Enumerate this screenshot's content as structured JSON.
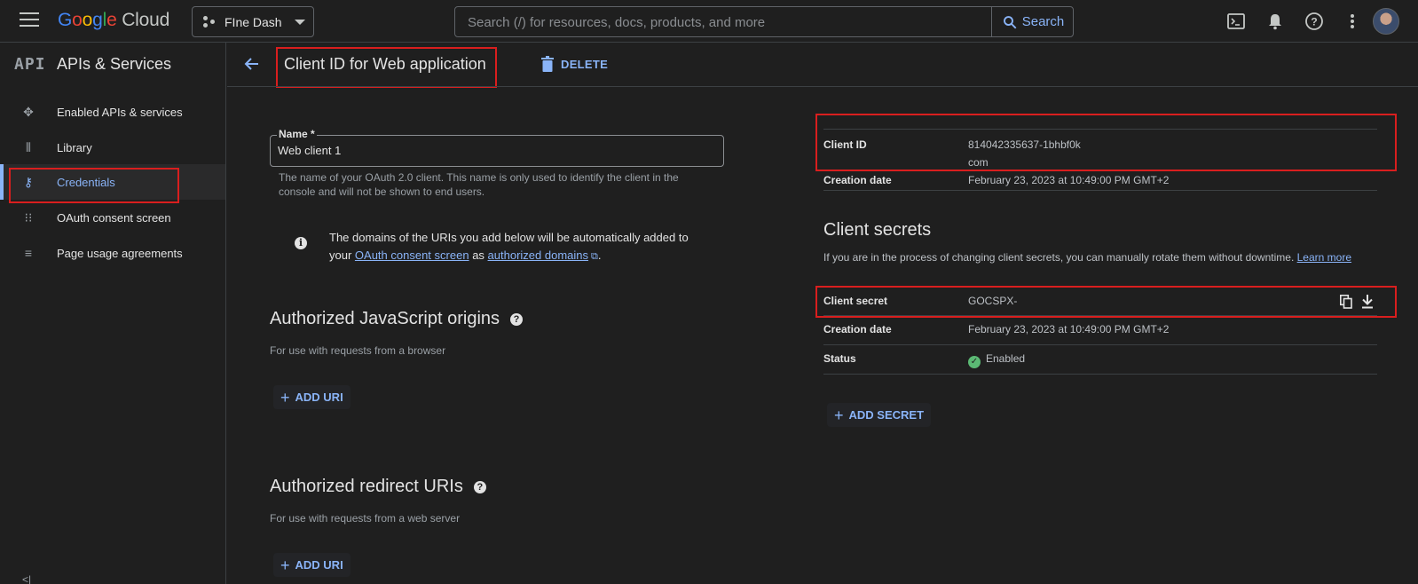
{
  "topbar": {
    "brand_google": [
      "G",
      "o",
      "o",
      "g",
      "l",
      "e"
    ],
    "brand_cloud": "Cloud",
    "project_name": "FIne Dash",
    "search_placeholder": "Search (/) for resources, docs, products, and more",
    "search_button": "Search"
  },
  "sidebar": {
    "logo_text": "API",
    "title": "APIs & Services",
    "items": [
      {
        "label": "Enabled APIs & services",
        "icon": "apis-hub-icon"
      },
      {
        "label": "Library",
        "icon": "library-icon"
      },
      {
        "label": "Credentials",
        "icon": "key-icon",
        "active": true
      },
      {
        "label": "OAuth consent screen",
        "icon": "consent-icon"
      },
      {
        "label": "Page usage agreements",
        "icon": "settings-list-icon"
      }
    ]
  },
  "header": {
    "title": "Client ID for Web application",
    "delete_label": "DELETE"
  },
  "form": {
    "name_label": "Name *",
    "name_value": "Web client 1",
    "name_help": "The name of your OAuth 2.0 client. This name is only used to identify the client in the console and will not be shown to end users.",
    "info_prefix": "The domains of the URIs you add below will be automatically added to your",
    "info_link1": "OAuth consent screen",
    "info_mid": "as",
    "info_link2": "authorized domains",
    "info_suffix": ".",
    "js_origins_title": "Authorized JavaScript origins",
    "js_origins_sub": "For use with requests from a browser",
    "add_uri_label": "ADD URI",
    "redirect_title": "Authorized redirect URIs",
    "redirect_sub": "For use with requests from a web server"
  },
  "client": {
    "client_id_label": "Client ID",
    "client_id_value_line1": "814042335637-1bhbf0k",
    "client_id_value_line2": "com",
    "creation_date_label": "Creation date",
    "creation_date_value": "February 23, 2023 at 10:49:00 PM GMT+2"
  },
  "secrets": {
    "title": "Client secrets",
    "description": "If you are in the process of changing client secrets, you can manually rotate them without downtime.",
    "learn_more": "Learn more",
    "secret_label": "Client secret",
    "secret_value": "GOCSPX-",
    "creation_date_label": "Creation date",
    "creation_date_value": "February 23, 2023 at 10:49:00 PM GMT+2",
    "status_label": "Status",
    "status_value": "Enabled",
    "add_secret_label": "ADD SECRET"
  },
  "colors": {
    "accent": "#8ab4f8",
    "highlight_box": "#d91e1e",
    "status_enabled": "#5bb974"
  }
}
